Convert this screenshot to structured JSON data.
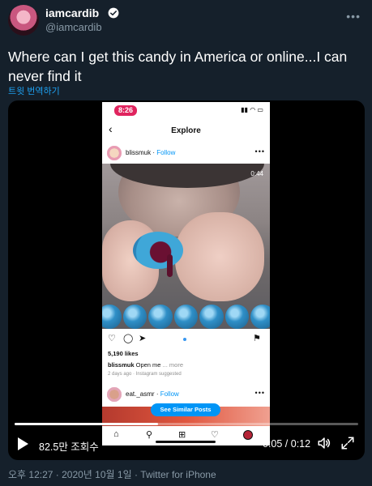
{
  "tweet": {
    "display_name": "iamcardib",
    "handle": "@iamcardib",
    "text": "Where can I get this candy in America or online...I can never find it",
    "translate_label": "트윗 번역하기",
    "more_glyph": "•••",
    "meta": "오후 12:27 · 2020년 10월 1일 · Twitter for iPhone"
  },
  "phone": {
    "status_time": "8:26",
    "status_icons": "▮▮ ◠ ▭",
    "screen_title": "Explore",
    "post1": {
      "user": "blissmuk",
      "follow": "Follow",
      "video_time": "0:44",
      "likes": "5,190 likes",
      "caption_user": "blissmuk",
      "caption_text": "Open me",
      "caption_more": "... more",
      "date": "2 days ago · Instagram suggested"
    },
    "post2": {
      "user": "eat._asmr",
      "follow": "Follow"
    },
    "similar_button": "See Similar Posts"
  },
  "player": {
    "views": "82.5만 조회수",
    "time_readout": "0:05 / 0:12",
    "progress": 0.417
  },
  "icons": {
    "verified": "verified-badge-icon",
    "play": "play-icon",
    "volume": "volume-icon",
    "fullscreen": "fullscreen-icon"
  },
  "colors": {
    "background": "#15202b",
    "link": "#1da1f2",
    "muted": "#8899a6",
    "instagram_blue": "#0095f6"
  }
}
